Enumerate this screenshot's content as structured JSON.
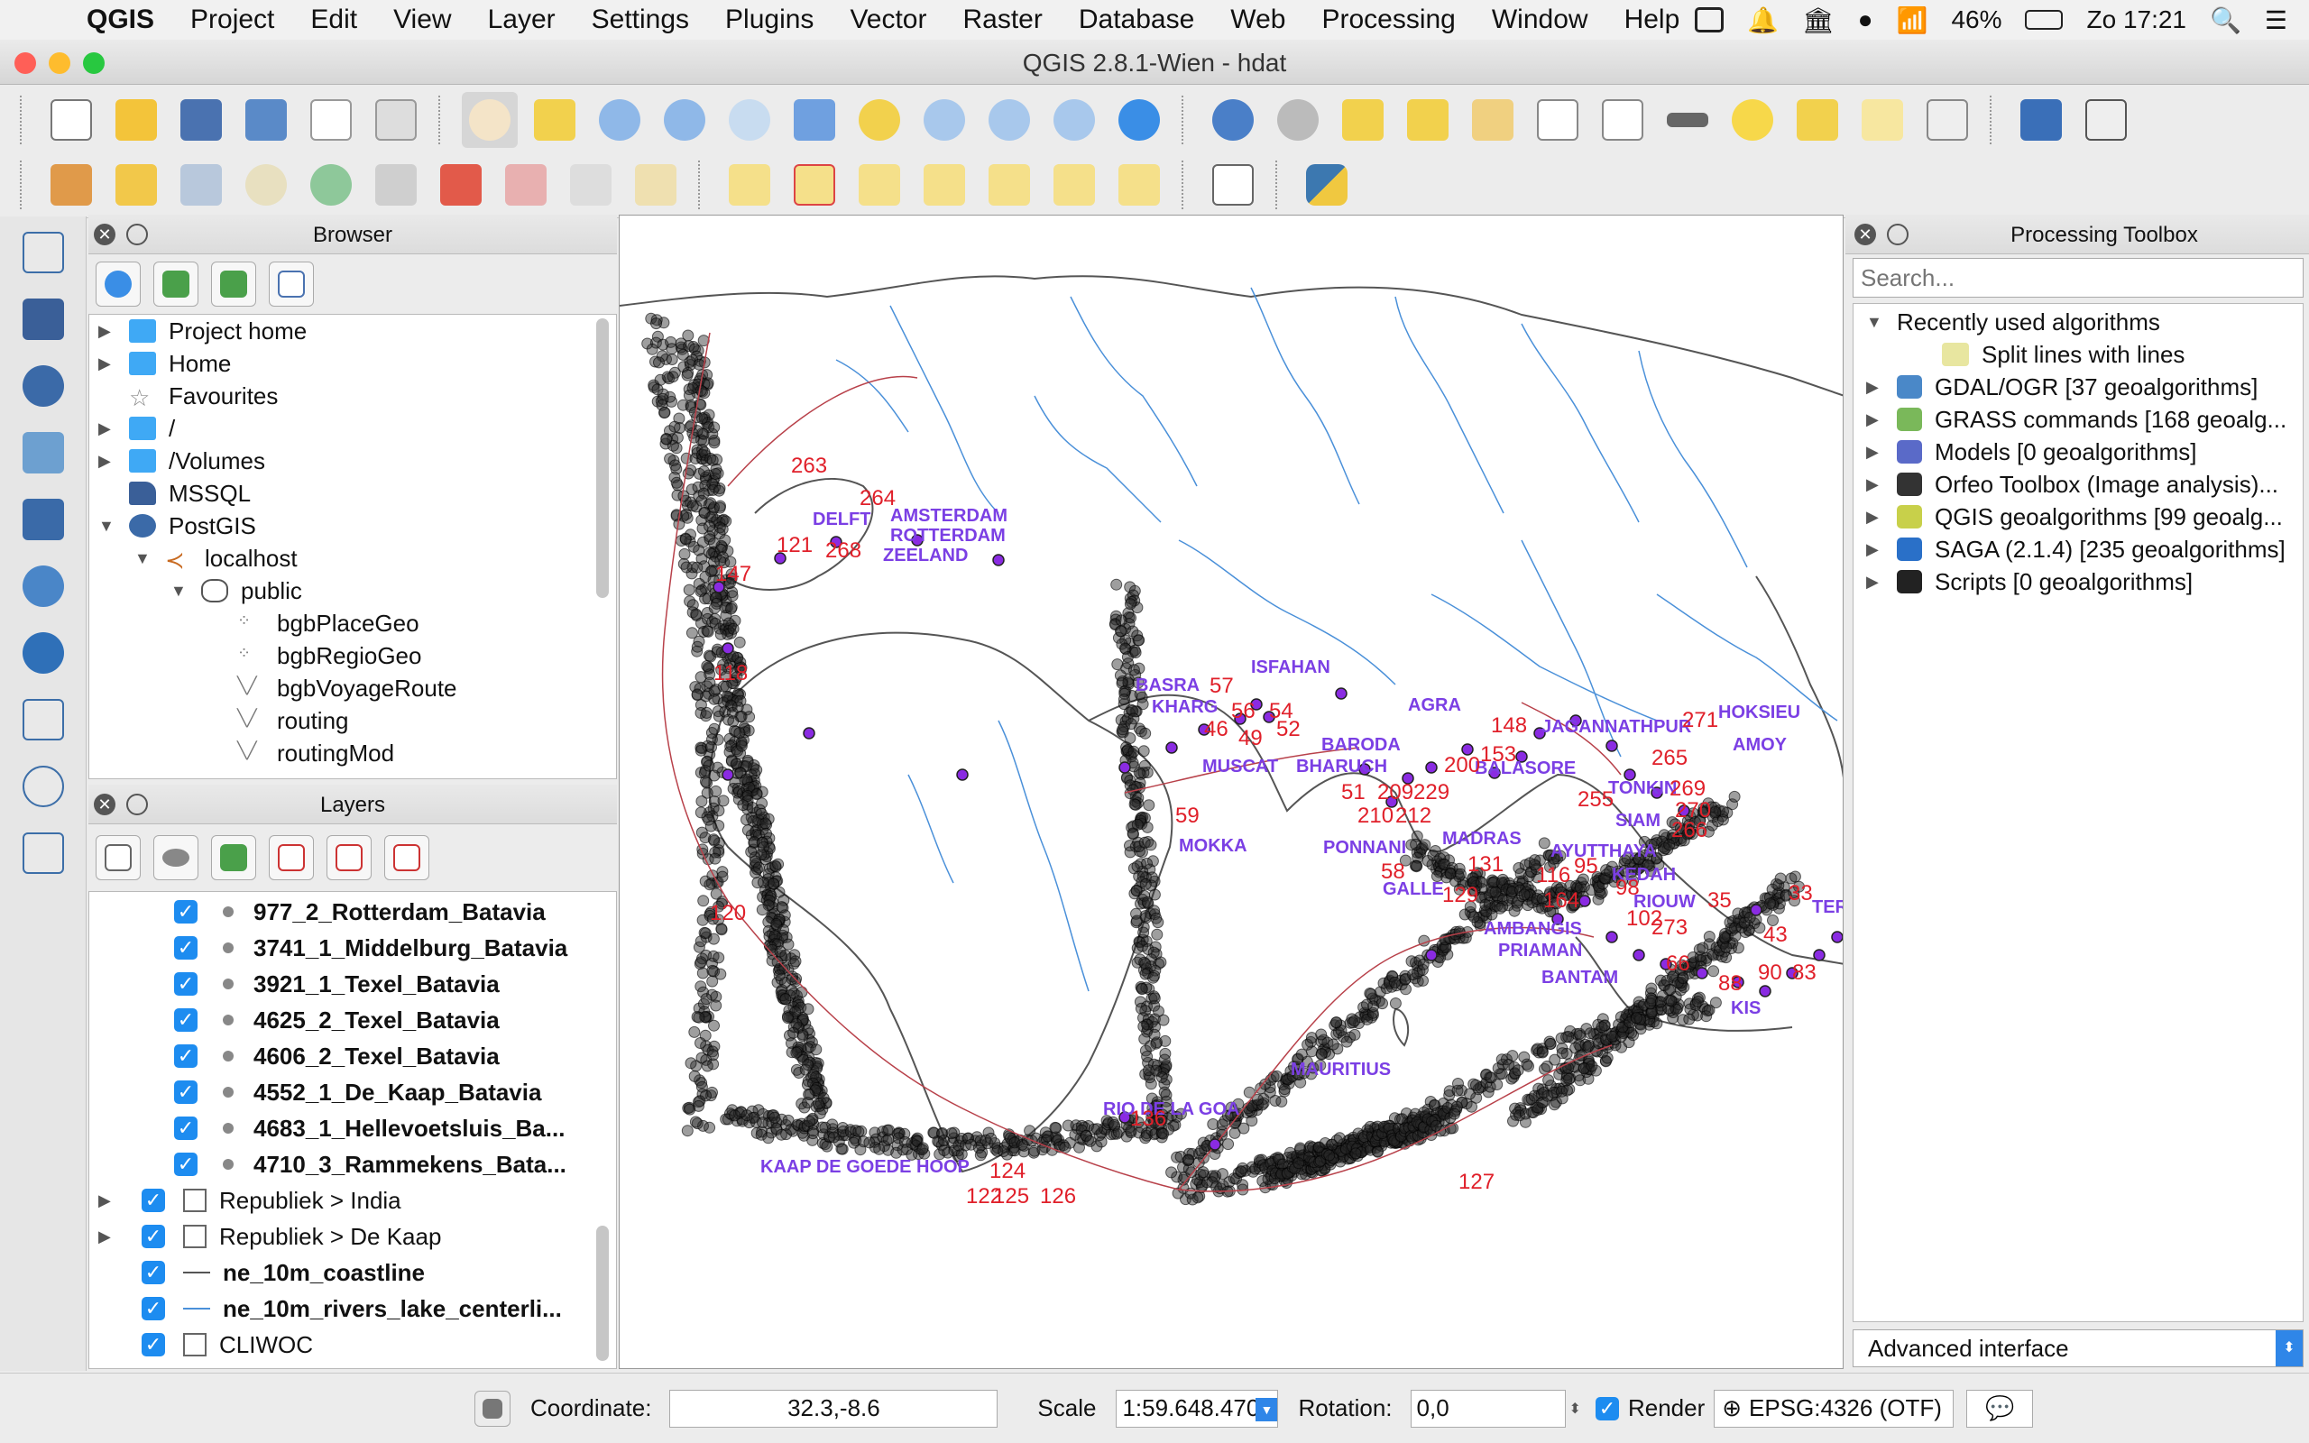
{
  "menubar": {
    "app": "QGIS",
    "items": [
      "Project",
      "Edit",
      "View",
      "Layer",
      "Settings",
      "Plugins",
      "Vector",
      "Raster",
      "Database",
      "Web",
      "Processing",
      "Window",
      "Help"
    ],
    "battery": "46%",
    "clock": "Zo 17:21"
  },
  "window": {
    "title": "QGIS 2.8.1-Wien - hdat"
  },
  "browser": {
    "title": "Browser",
    "items": [
      {
        "label": "Project home",
        "icon": "folder-icon",
        "expander": "▶"
      },
      {
        "label": "Home",
        "icon": "folder-icon",
        "expander": "▶"
      },
      {
        "label": "Favourites",
        "icon": "star-icon",
        "expander": ""
      },
      {
        "label": "/",
        "icon": "folder-icon",
        "expander": "▶"
      },
      {
        "label": "/Volumes",
        "icon": "folder-icon",
        "expander": "▶"
      },
      {
        "label": "MSSQL",
        "icon": "mssql-icon",
        "expander": ""
      },
      {
        "label": "PostGIS",
        "icon": "postgis-icon",
        "expander": "▼"
      },
      {
        "label": "localhost",
        "icon": "connection-icon",
        "expander": "▼"
      },
      {
        "label": "public",
        "icon": "schema-icon",
        "expander": "▼"
      },
      {
        "label": "bgbPlaceGeo",
        "icon": "point-layer-icon",
        "expander": ""
      },
      {
        "label": "bgbRegioGeo",
        "icon": "point-layer-icon",
        "expander": ""
      },
      {
        "label": "bgbVoyageRoute",
        "icon": "line-layer-icon",
        "expander": ""
      },
      {
        "label": "routing",
        "icon": "line-layer-icon",
        "expander": ""
      },
      {
        "label": "routingMod",
        "icon": "line-layer-icon",
        "expander": ""
      }
    ]
  },
  "layers": {
    "title": "Layers",
    "items": [
      {
        "label": "977_2_Rotterdam_Batavia",
        "bold": true,
        "kind": "point"
      },
      {
        "label": "3741_1_Middelburg_Batavia",
        "bold": true,
        "kind": "point"
      },
      {
        "label": "3921_1_Texel_Batavia",
        "bold": true,
        "kind": "point"
      },
      {
        "label": "4625_2_Texel_Batavia",
        "bold": true,
        "kind": "point"
      },
      {
        "label": "4606_2_Texel_Batavia",
        "bold": true,
        "kind": "point"
      },
      {
        "label": "4552_1_De_Kaap_Batavia",
        "bold": true,
        "kind": "point"
      },
      {
        "label": "4683_1_Hellevoetsluis_Ba...",
        "bold": true,
        "kind": "point"
      },
      {
        "label": "4710_3_Rammekens_Bata...",
        "bold": true,
        "kind": "point"
      },
      {
        "label": "Republiek > India",
        "bold": false,
        "kind": "group",
        "expander": "▶"
      },
      {
        "label": "Republiek > De Kaap",
        "bold": false,
        "kind": "group",
        "expander": "▶"
      },
      {
        "label": "ne_10m_coastline",
        "bold": true,
        "kind": "line-dark"
      },
      {
        "label": "ne_10m_rivers_lake_centerli...",
        "bold": true,
        "kind": "line-blue"
      },
      {
        "label": "CLIWOC",
        "bold": false,
        "kind": "group"
      }
    ]
  },
  "toolbox": {
    "title": "Processing Toolbox",
    "search_placeholder": "Search...",
    "recent": "Recently used algorithms",
    "recent_item": "Split lines with lines",
    "providers": [
      "GDAL/OGR [37 geoalgorithms]",
      "GRASS commands [168 geoalg...",
      "Models [0 geoalgorithms]",
      "Orfeo Toolbox (Image analysis)...",
      "QGIS geoalgorithms [99 geoalg...",
      "SAGA (2.1.4) [235 geoalgorithms]",
      "Scripts [0 geoalgorithms]"
    ],
    "advanced": "Advanced interface"
  },
  "map": {
    "places": [
      {
        "t": "DELFT"
      },
      {
        "t": "AMSTERDAM"
      },
      {
        "t": "ROTTERDAM"
      },
      {
        "t": "ZEELAND"
      },
      {
        "t": "ISFAHAN"
      },
      {
        "t": "BASRA"
      },
      {
        "t": "KHARG"
      },
      {
        "t": "MUSCAT"
      },
      {
        "t": "BARODA"
      },
      {
        "t": "BHARUCH"
      },
      {
        "t": "AGRA"
      },
      {
        "t": "JAGANNATHPUR"
      },
      {
        "t": "BALASORE"
      },
      {
        "t": "TONKIN"
      },
      {
        "t": "HOKSIEU"
      },
      {
        "t": "AMOY"
      },
      {
        "t": "MOKKA"
      },
      {
        "t": "PONNANI"
      },
      {
        "t": "MADRAS"
      },
      {
        "t": "AYUTTHAYA"
      },
      {
        "t": "SIAM"
      },
      {
        "t": "KEDAH"
      },
      {
        "t": "GALLE"
      },
      {
        "t": "RIOUW"
      },
      {
        "t": "AMBANGIS"
      },
      {
        "t": "PRIAMAN"
      },
      {
        "t": "BANTAM"
      },
      {
        "t": "KIS"
      },
      {
        "t": "MAURITIUS"
      },
      {
        "t": "RIO DE LA GOA"
      },
      {
        "t": "KAAP DE GOEDE HOOP"
      },
      {
        "t": "TER"
      }
    ],
    "numbers": [
      {
        "t": "263"
      },
      {
        "t": "264"
      },
      {
        "t": "121"
      },
      {
        "t": "268"
      },
      {
        "t": "147"
      },
      {
        "t": "118"
      },
      {
        "t": "120"
      },
      {
        "t": "57"
      },
      {
        "t": "56"
      },
      {
        "t": "54"
      },
      {
        "t": "46"
      },
      {
        "t": "49"
      },
      {
        "t": "52"
      },
      {
        "t": "59"
      },
      {
        "t": "51"
      },
      {
        "t": "210"
      },
      {
        "t": "212"
      },
      {
        "t": "209"
      },
      {
        "t": "229"
      },
      {
        "t": "200"
      },
      {
        "t": "148"
      },
      {
        "t": "153"
      },
      {
        "t": "255"
      },
      {
        "t": "265"
      },
      {
        "t": "269"
      },
      {
        "t": "270"
      },
      {
        "t": "271"
      },
      {
        "t": "266"
      },
      {
        "t": "131"
      },
      {
        "t": "116"
      },
      {
        "t": "164"
      },
      {
        "t": "95"
      },
      {
        "t": "98"
      },
      {
        "t": "102"
      },
      {
        "t": "273"
      },
      {
        "t": "35"
      },
      {
        "t": "33"
      },
      {
        "t": "88"
      },
      {
        "t": "83"
      },
      {
        "t": "90"
      },
      {
        "t": "66"
      },
      {
        "t": "136"
      },
      {
        "t": "124"
      },
      {
        "t": "122"
      },
      {
        "t": "125"
      },
      {
        "t": "126"
      },
      {
        "t": "127"
      },
      {
        "t": "129"
      },
      {
        "t": "58"
      },
      {
        "t": "43"
      }
    ]
  },
  "status": {
    "coordinate_label": "Coordinate:",
    "coordinate_value": "32.3,-8.6",
    "scale_label": "Scale",
    "scale_value": "1:59.648.470",
    "rotation_label": "Rotation:",
    "rotation_value": "0,0",
    "render_label": "Render",
    "crs": "EPSG:4326 (OTF)"
  },
  "colors": {
    "accent": "#1d8cf0",
    "place_label": "#7b3fe4",
    "voyage_number": "#e0202a",
    "river": "#4a90d9"
  }
}
